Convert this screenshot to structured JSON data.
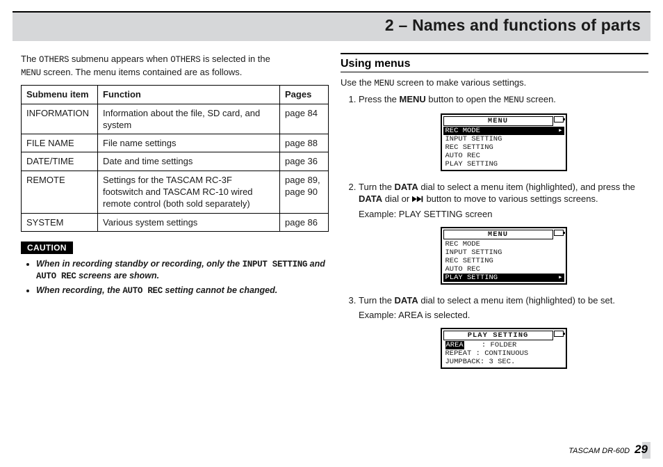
{
  "header": {
    "title": "2 – Names and functions of parts"
  },
  "left": {
    "intro_a": "The ",
    "intro_b": " submenu appears when ",
    "intro_c": " is selected in the ",
    "intro_d": " screen. The menu items contained are as follows.",
    "mono_others": "OTHERS",
    "mono_menu": "MENU",
    "table": {
      "head": {
        "submenu": "Submenu item",
        "function": "Function",
        "pages": "Pages"
      },
      "rows": [
        {
          "submenu": "INFORMATION",
          "function": "Information about the file, SD card, and system",
          "pages": "page 84"
        },
        {
          "submenu": "FILE NAME",
          "function": "File name settings",
          "pages": "page 88"
        },
        {
          "submenu": "DATE/TIME",
          "function": "Date and time settings",
          "pages": "page 36"
        },
        {
          "submenu": "REMOTE",
          "function": "Settings for the TASCAM RC-3F footswitch and TASCAM RC-10 wired remote control (both sold separately)",
          "pages": "page 89, page 90"
        },
        {
          "submenu": "SYSTEM",
          "function": "Various system settings",
          "pages": "page 86"
        }
      ]
    },
    "caution_label": "CAUTION",
    "caution1_a": "When in recording standby or recording, only the ",
    "caution1_b": " and ",
    "caution1_c": " screens are shown.",
    "mono_input_setting": "INPUT SETTING",
    "mono_auto_rec": "AUTO REC",
    "caution2_a": "When recording, the ",
    "caution2_b": " setting cannot be changed."
  },
  "right": {
    "sec_title": "Using menus",
    "intro_a": "Use the ",
    "intro_b": " screen to make various settings.",
    "mono_menu": "MENU",
    "step1_a": "Press the ",
    "step1_b": " button to open the ",
    "step1_c": " screen.",
    "bold_menu": "MENU",
    "step2_a": "Turn the ",
    "step2_b": " dial to select a menu item (highlighted), and press the ",
    "step2_c": " dial or ",
    "step2_d": " button to move to various settings screens.",
    "bold_data": "DATA",
    "step2_ex": "Example: PLAY SETTING screen",
    "step3_a": "Turn the ",
    "step3_b": " dial to select a menu item (highlighted) to be set.",
    "step3_ex": "Example: AREA is selected.",
    "lcd1": {
      "title": "MENU",
      "rows": [
        "REC MODE",
        "INPUT SETTING",
        "REC SETTING",
        "AUTO REC",
        "PLAY SETTING"
      ],
      "hl": 0
    },
    "lcd2": {
      "title": "MENU",
      "rows": [
        "REC MODE",
        "INPUT SETTING",
        "REC SETTING",
        "AUTO REC",
        "PLAY SETTING"
      ],
      "hl": 4
    },
    "lcd3": {
      "title": "PLAY SETTING",
      "rows": [
        "AREA    : FOLDER",
        "REPEAT  : CONTINUOUS",
        "JUMPBACK: 3 SEC."
      ],
      "hl_segment": "AREA"
    }
  },
  "footer": {
    "model": "TASCAM  DR-60D",
    "page": "29"
  }
}
